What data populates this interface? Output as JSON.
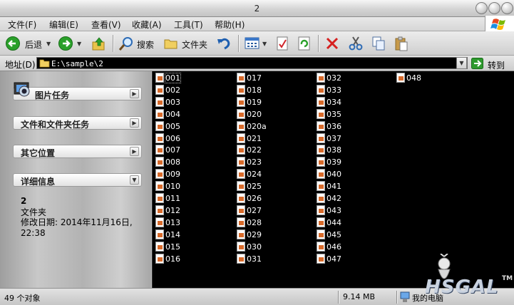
{
  "window": {
    "title": "2"
  },
  "menu": [
    "文件(F)",
    "编辑(E)",
    "查看(V)",
    "收藏(A)",
    "工具(T)",
    "帮助(H)"
  ],
  "toolbar": {
    "back": "后退",
    "search": "搜索",
    "folders": "文件夹"
  },
  "address": {
    "label": "地址(D)",
    "path": "E:\\sample\\2",
    "go": "转到"
  },
  "left_tasks": {
    "picture_tasks": "图片任务",
    "file_folder_tasks": "文件和文件夹任务",
    "other_places": "其它位置",
    "details": "详细信息"
  },
  "details": {
    "name": "2",
    "type": "文件夹",
    "modified": "修改日期: 2014年11月16日, 22:38"
  },
  "files": [
    [
      "001",
      "002",
      "003",
      "004",
      "005",
      "006",
      "007",
      "008",
      "009",
      "010",
      "011",
      "012",
      "013",
      "014",
      "015",
      "016"
    ],
    [
      "017",
      "018",
      "019",
      "020",
      "020a",
      "021",
      "022",
      "023",
      "024",
      "025",
      "026",
      "027",
      "028",
      "029",
      "030",
      "031"
    ],
    [
      "032",
      "033",
      "034",
      "035",
      "036",
      "037",
      "038",
      "039",
      "040",
      "041",
      "042",
      "043",
      "044",
      "045",
      "046",
      "047"
    ],
    [
      "048"
    ]
  ],
  "status": {
    "objects": "49 个对象",
    "size": "9.14 MB",
    "location": "我的电脑"
  },
  "colors": {
    "file_pane_bg": "#000000",
    "accent_go": "#2e9a2e"
  },
  "watermark": {
    "text": "HSGAL",
    "tm": "TM"
  }
}
